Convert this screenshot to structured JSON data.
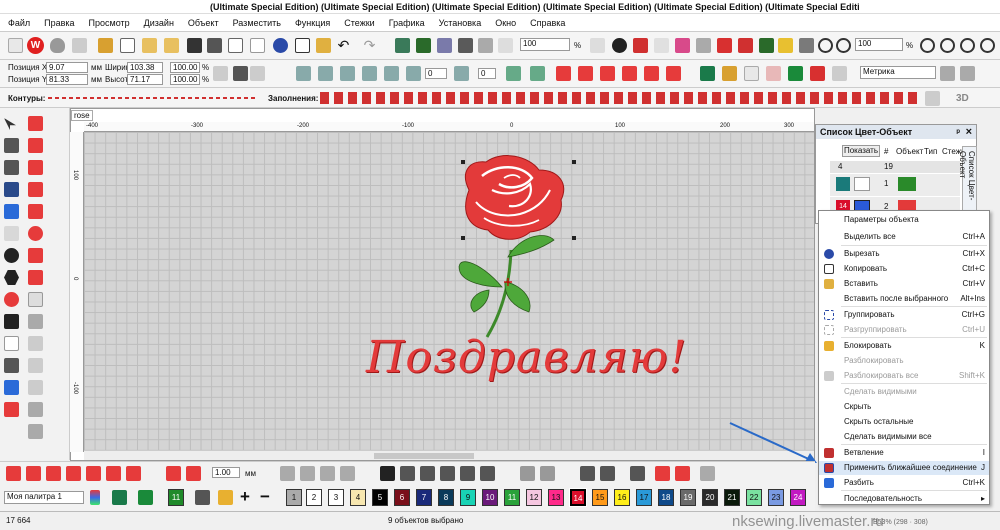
{
  "window": {
    "title": "(Ultimate Special Edition) (Ultimate Special Edition) (Ultimate Special Edition) (Ultimate Special Edition) (Ultimate Special Edition) (Ultimate Special Editi"
  },
  "menu": [
    "Файл",
    "Правка",
    "Просмотр",
    "Дизайн",
    "Объект",
    "Разместить",
    "Функция",
    "Стежки",
    "Графика",
    "Установка",
    "Окно",
    "Справка"
  ],
  "toolbar": {
    "zoom_left": "100",
    "zoom_left_unit": "%",
    "zoom_right": "100",
    "zoom_right_unit": "%"
  },
  "position": {
    "x_label": "Позиция X:",
    "x_value": "9.07",
    "x_unit": "мм",
    "y_label": "Позиция Y:",
    "y_value": "81.33",
    "y_unit": "мм",
    "w_label": "Ширина:",
    "w_value": "103.38",
    "w_unit": "мм",
    "w_pct": "100.00",
    "w_pct_unit": "%",
    "h_label": "Высота:",
    "h_value": "71.17",
    "h_unit": "мм",
    "h_pct": "100.00",
    "h_pct_unit": "%",
    "rot1": "0",
    "rot2": "0",
    "units_select": "Метрика"
  },
  "contours_label": "Контуры:",
  "fills_label": "Заполнения:",
  "mode_3d": "3D",
  "document": {
    "tab": "rose",
    "hruler": [
      "-400",
      "-300",
      "-200",
      "-100",
      "0",
      "100",
      "200",
      "300"
    ],
    "vruler": [
      "100",
      "0",
      "-100"
    ],
    "text": "Поздравляю!"
  },
  "panel": {
    "title": "Список Цвет-Объект",
    "pin": "ᵖ",
    "close": "×",
    "show_button": "Показать",
    "cols": [
      "#",
      "Объект",
      "Тип",
      "Стежк"
    ],
    "rows": [
      {
        "a": "4",
        "b": "19"
      },
      {
        "a": "",
        "b": "1"
      },
      {
        "a": "14",
        "b": "2"
      }
    ],
    "side_tab": "Список Цвет-Объект"
  },
  "context_menu": [
    {
      "label": "Параметры объекта",
      "shortcut": "",
      "disabled": false
    },
    {
      "label": "Выделить все",
      "shortcut": "Ctrl+A",
      "disabled": false
    },
    {
      "label": "Вырезать",
      "shortcut": "Ctrl+X",
      "disabled": false
    },
    {
      "label": "Копировать",
      "shortcut": "Ctrl+C",
      "disabled": false
    },
    {
      "label": "Вставить",
      "shortcut": "Ctrl+V",
      "disabled": false
    },
    {
      "label": "Вставить после выбранного",
      "shortcut": "Alt+Ins",
      "disabled": false
    },
    {
      "label": "Группировать",
      "shortcut": "Ctrl+G",
      "disabled": false
    },
    {
      "label": "Разгруппировать",
      "shortcut": "Ctrl+U",
      "disabled": true
    },
    {
      "label": "Блокировать",
      "shortcut": "K",
      "disabled": false
    },
    {
      "label": "Разблокировать",
      "shortcut": "",
      "disabled": true
    },
    {
      "label": "Разблокировать все",
      "shortcut": "Shift+K",
      "disabled": true
    },
    {
      "label": "Сделать видимыми",
      "shortcut": "",
      "disabled": true
    },
    {
      "label": "Скрыть",
      "shortcut": "",
      "disabled": false
    },
    {
      "label": "Скрыть остальные",
      "shortcut": "",
      "disabled": false
    },
    {
      "label": "Сделать видимыми все",
      "shortcut": "",
      "disabled": false
    },
    {
      "label": "Ветвление",
      "shortcut": "I",
      "disabled": false
    },
    {
      "label": "Применить ближайшее соединение",
      "shortcut": "J",
      "disabled": false
    },
    {
      "label": "Разбить",
      "shortcut": "Ctrl+K",
      "disabled": false
    },
    {
      "label": "Последовательность",
      "shortcut": "▸",
      "disabled": false
    }
  ],
  "bottom": {
    "size_value": "1.00",
    "size_unit": "мм",
    "palette_name": "Моя палитра 1"
  },
  "palette": [
    {
      "n": "11",
      "c": "#1f8a2a"
    },
    {
      "n": "1",
      "c": "#aaaaaa"
    },
    {
      "n": "2",
      "c": "#ffffff"
    },
    {
      "n": "3",
      "c": "#ffffff"
    },
    {
      "n": "4",
      "c": "#f7e7b0"
    },
    {
      "n": "5",
      "c": "#000000"
    },
    {
      "n": "6",
      "c": "#7a0f1a"
    },
    {
      "n": "7",
      "c": "#1a2a7a"
    },
    {
      "n": "8",
      "c": "#0a3a5a"
    },
    {
      "n": "9",
      "c": "#19d3b5"
    },
    {
      "n": "10",
      "c": "#6a1a7a"
    },
    {
      "n": "11",
      "c": "#2aa23a"
    },
    {
      "n": "12",
      "c": "#f5c6e0"
    },
    {
      "n": "13",
      "c": "#ff2a8a"
    },
    {
      "n": "14",
      "c": "#d90e2b"
    },
    {
      "n": "15",
      "c": "#ff9a1a"
    },
    {
      "n": "16",
      "c": "#ffee1a"
    },
    {
      "n": "17",
      "c": "#2a9ad8"
    },
    {
      "n": "18",
      "c": "#0f4a8a"
    },
    {
      "n": "19",
      "c": "#6a6a6a"
    },
    {
      "n": "20",
      "c": "#2a2a2a"
    },
    {
      "n": "21",
      "c": "#0a1a0a"
    },
    {
      "n": "22",
      "c": "#7ae2a0"
    },
    {
      "n": "23",
      "c": "#7a9ae2"
    },
    {
      "n": "24",
      "c": "#c21ac2"
    }
  ],
  "status": {
    "count": "17 664",
    "selection": "9 объектов выбрано",
    "zoom": "B53% (298 · 308)"
  },
  "watermark": "nksewing.livemaster.ru"
}
